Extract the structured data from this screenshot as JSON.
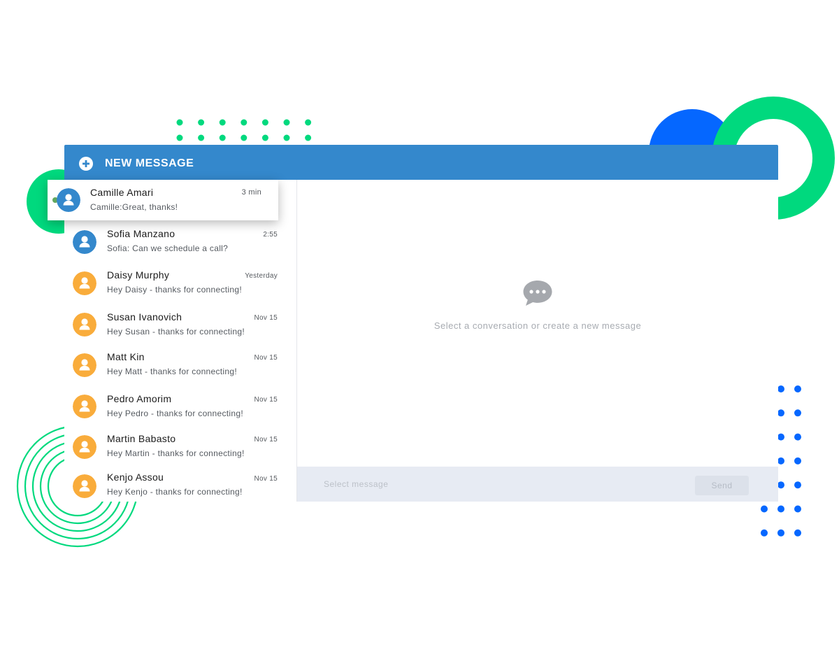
{
  "colors": {
    "header": "#3488cc",
    "avatar_blue": "#3488cc",
    "avatar_orange": "#f9ac3b",
    "deco_green": "#00d97e",
    "deco_blue": "#0567ff"
  },
  "header": {
    "icon": "plus-circle-icon",
    "label": "NEW MESSAGE"
  },
  "active_conversation": {
    "name": "Camille Amari",
    "preview": "Camille:Great, thanks!",
    "time": "3 min",
    "avatar_color": "#3488cc",
    "status": "online"
  },
  "conversations": [
    {
      "name": "Sofia Manzano",
      "preview": "Sofia: Can we schedule a call?",
      "time": "2:55",
      "avatar_color": "#3488cc"
    },
    {
      "name": "Daisy Murphy",
      "preview": "Hey Daisy - thanks for connecting!",
      "time": "Yesterday",
      "avatar_color": "#f9ac3b"
    },
    {
      "name": "Susan Ivanovich",
      "preview": "Hey Susan - thanks for connecting!",
      "time": "Nov 15",
      "avatar_color": "#f9ac3b"
    },
    {
      "name": "Matt Kin",
      "preview": "Hey Matt - thanks for connecting!",
      "time": "Nov 15",
      "avatar_color": "#f9ac3b"
    },
    {
      "name": "Pedro Amorim",
      "preview": "Hey Pedro - thanks for connecting!",
      "time": "Nov 15",
      "avatar_color": "#f9ac3b"
    },
    {
      "name": "Martin Babasto",
      "preview": "Hey Martin - thanks for connecting!",
      "time": "Nov 15",
      "avatar_color": "#f9ac3b"
    },
    {
      "name": "Kenjo Assou",
      "preview": "Hey Kenjo - thanks for connecting!",
      "time": "Nov 15",
      "avatar_color": "#f9ac3b"
    }
  ],
  "empty_state": {
    "icon": "chat-bubble-icon",
    "text": "Select a conversation or create a new message"
  },
  "composer": {
    "placeholder": "Select message",
    "value": "",
    "send_label": "Send"
  }
}
